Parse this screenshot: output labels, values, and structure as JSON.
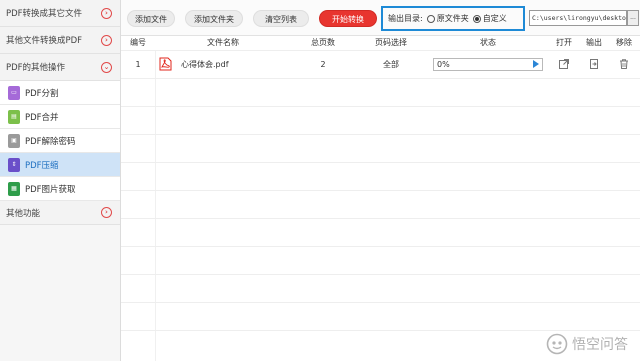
{
  "sidebar": {
    "sections": [
      {
        "label": "PDF转换成其它文件"
      },
      {
        "label": "其他文件转换成PDF"
      },
      {
        "label": "PDF的其他操作"
      }
    ],
    "items": [
      {
        "label": "PDF分割"
      },
      {
        "label": "PDF合并"
      },
      {
        "label": "PDF解除密码"
      },
      {
        "label": "PDF压缩"
      },
      {
        "label": "PDF图片获取"
      }
    ],
    "other": {
      "label": "其他功能"
    }
  },
  "toolbar": {
    "add_file": "添加文件",
    "add_folder": "添加文件夹",
    "clear_list": "清空列表",
    "start": "开始转换",
    "output_label": "输出目录:",
    "opt_original": "原文件夹",
    "opt_custom": "自定义",
    "path": "C:\\users\\lirongyu\\desktop",
    "browse": "..."
  },
  "table": {
    "headers": [
      "编号",
      "文件名称",
      "总页数",
      "页码选择",
      "状态",
      "打开",
      "输出",
      "移除"
    ],
    "rows": [
      {
        "index": "1",
        "name": "心得体会.pdf",
        "pages": "2",
        "range": "全部",
        "progress": "0%"
      }
    ]
  },
  "watermark": {
    "text": "悟空问答"
  },
  "colors": {
    "accent": "#1e8ad6",
    "start_button": "#e8352f",
    "active_item": "#cfe3f7",
    "pdf_red": "#e1251b"
  }
}
